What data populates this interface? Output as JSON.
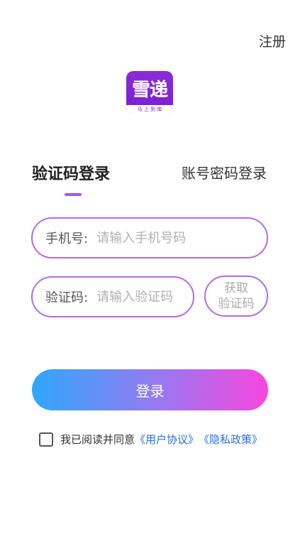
{
  "header": {
    "register_label": "注册"
  },
  "logo": {
    "text": "雪递",
    "subtext": "马 上 到 库"
  },
  "tabs": {
    "sms_login": "验证码登录",
    "password_login": "账号密码登录"
  },
  "phone_field": {
    "label": "手机号:",
    "placeholder": "请输入手机号码",
    "value": ""
  },
  "code_field": {
    "label": "验证码:",
    "placeholder": "请输入验证码",
    "value": ""
  },
  "get_code_button": {
    "line1": "获取",
    "line2": "验证码"
  },
  "login_button": {
    "label": "登录"
  },
  "agreement": {
    "text": "我已阅读并同意",
    "user_agreement": "《用户协议》",
    "privacy_policy": "《隐私政策》",
    "checked": false
  }
}
